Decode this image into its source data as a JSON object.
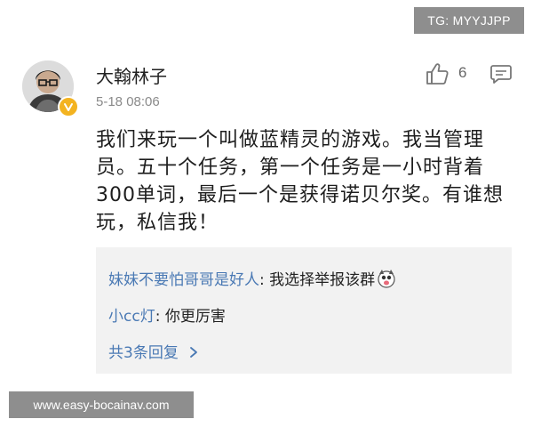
{
  "watermarks": {
    "top": "TG: MYYJJPP",
    "bottom": "www.easy-bocainav.com"
  },
  "post": {
    "username": "大翰林子",
    "timestamp": "5-18 08:06",
    "like_count": "6",
    "text": "我们来玩一个叫做蓝精灵的游戏。我当管理员。五十个任务，第一个任务是一小时背着300单词，最后一个是获得诺贝尔奖。有谁想玩，私信我！",
    "verified_badge_color": "#f3b320"
  },
  "replies": [
    {
      "user": "妹妹不要怕哥哥是好人",
      "separator": ": ",
      "text": "我选择举报该群",
      "emoji": "dog-emoji"
    },
    {
      "user": "小cc灯",
      "separator": ": ",
      "text": "你更厉害"
    }
  ],
  "more_replies_label": "共3条回复",
  "colors": {
    "link": "#4a79b4",
    "reply_background": "#f2f2f2",
    "watermark_background": "#8e8e8e"
  }
}
